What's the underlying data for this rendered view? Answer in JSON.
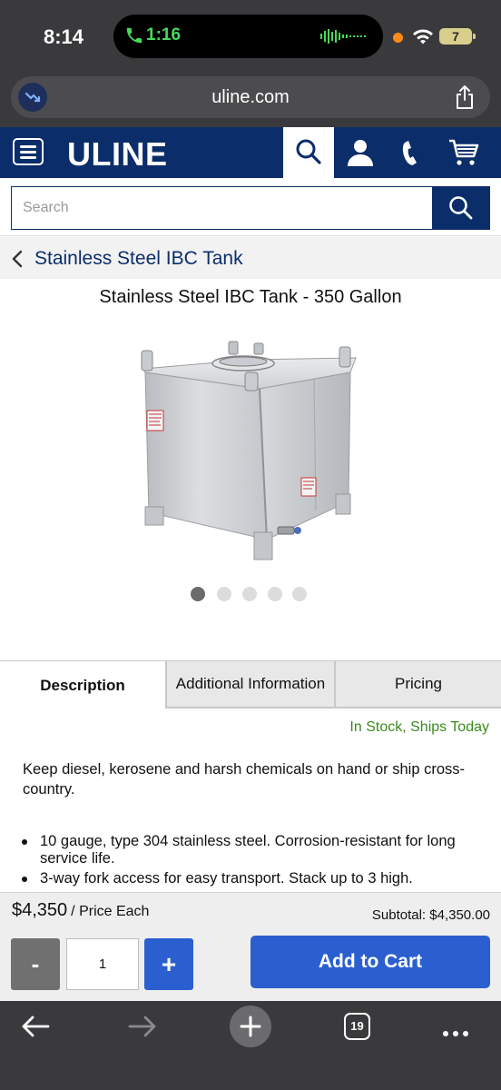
{
  "status_bar": {
    "time": "8:14",
    "call_timer": "1:16",
    "battery": "7"
  },
  "browser": {
    "url": "uline.com",
    "tab_count": "19"
  },
  "header": {
    "logo": "ULINE",
    "colors": {
      "brand_navy": "#0b2d6a",
      "action_blue": "#2b5fcf",
      "stock_green": "#3a8a1c"
    }
  },
  "search": {
    "placeholder": "Search",
    "value": ""
  },
  "breadcrumb": {
    "label": "Stainless Steel IBC Tank"
  },
  "product": {
    "title": "Stainless Steel IBC Tank - 350 Gallon",
    "image_count": 5,
    "active_image_index": 1
  },
  "tabs": [
    {
      "label": "Description",
      "active": true
    },
    {
      "label": "Additional Information",
      "active": false
    },
    {
      "label": "Pricing",
      "active": false
    }
  ],
  "stock_status": "In Stock, Ships Today",
  "description": {
    "intro": "Keep diesel, kerosene and harsh chemicals on hand or ship cross-country.",
    "bullets": [
      "10 gauge, type 304 stainless steel. Corrosion-resistant for long service life.",
      "3-way fork access for easy transport. Stack up to 3 high."
    ]
  },
  "cart": {
    "price": "$4,350",
    "price_unit": "/ Price Each",
    "subtotal": "Subtotal: $4,350.00",
    "minus_label": "-",
    "plus_label": "+",
    "quantity": "1",
    "add_to_cart_label": "Add to Cart"
  }
}
